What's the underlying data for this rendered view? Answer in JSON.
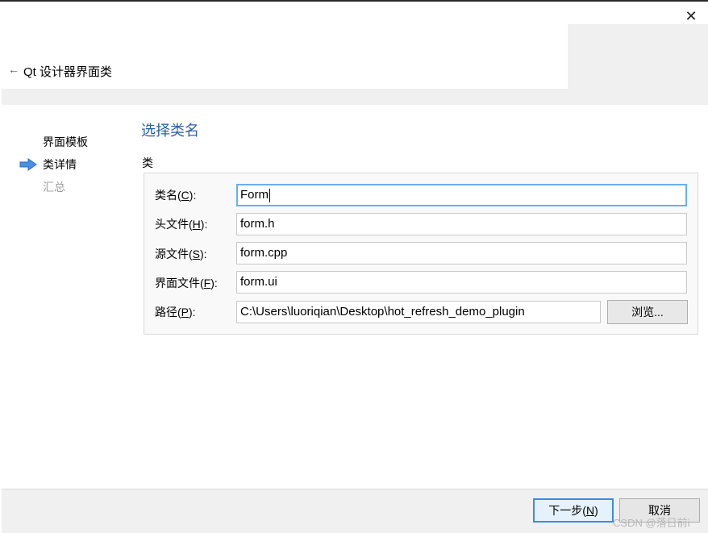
{
  "header": {
    "title": "Qt 设计器界面类",
    "back_icon": "←",
    "close_icon": "✕"
  },
  "steps": [
    {
      "label": "界面模板",
      "state": "done"
    },
    {
      "label": "类详情",
      "state": "current"
    },
    {
      "label": "汇总",
      "state": "pending"
    }
  ],
  "page": {
    "title": "选择类名",
    "group_label": "类"
  },
  "form": {
    "class_name": {
      "label_pre": "类名(",
      "mnemonic": "C",
      "label_post": "):",
      "value": "Form"
    },
    "header_file": {
      "label_pre": "头文件(",
      "mnemonic": "H",
      "label_post": "):",
      "value": "form.h"
    },
    "source_file": {
      "label_pre": "源文件(",
      "mnemonic": "S",
      "label_post": "):",
      "value": "form.cpp"
    },
    "ui_file": {
      "label_pre": "界面文件(",
      "mnemonic": "F",
      "label_post": "):",
      "value": "form.ui"
    },
    "path": {
      "label_pre": "路径(",
      "mnemonic": "P",
      "label_post": "):",
      "value": "C:\\Users\\luoriqian\\Desktop\\hot_refresh_demo_plugin"
    },
    "browse_label": "浏览..."
  },
  "footer": {
    "next_pre": "下一步(",
    "next_mnemonic": "N",
    "next_post": ")",
    "cancel_label": "取消"
  },
  "watermark": "CSDN @落日前i",
  "colors": {
    "title_blue": "#2d5fa0",
    "arrow_blue": "#4a8ee6",
    "focus_border": "#6aaef0"
  }
}
